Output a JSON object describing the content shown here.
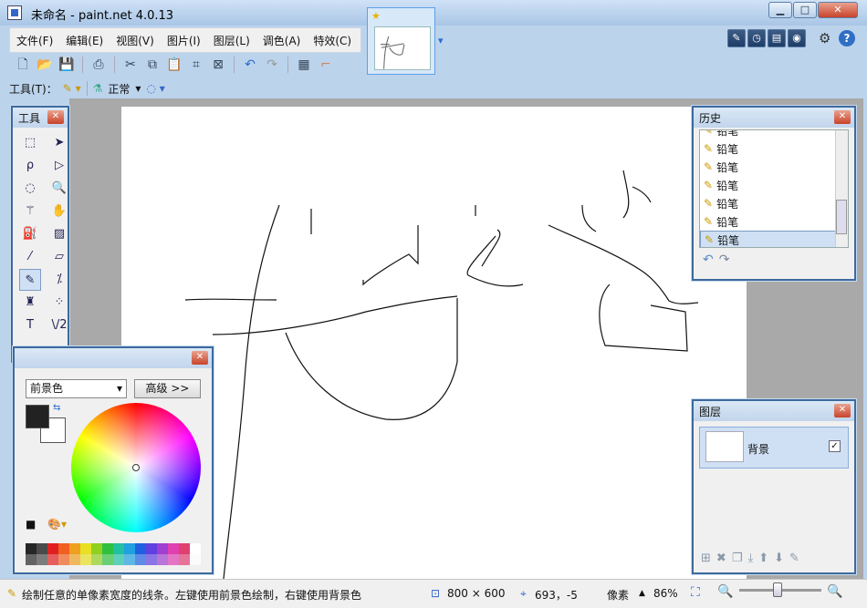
{
  "window": {
    "title": "未命名 - paint.net 4.0.13",
    "min": "▁",
    "max": "□",
    "close": "✕"
  },
  "menu": [
    "文件(F)",
    "编辑(E)",
    "视图(V)",
    "图片(I)",
    "图层(L)",
    "调色(A)",
    "特效(C)"
  ],
  "toolopts": {
    "tool_label": "工具(T)：",
    "blend_mode": "正常"
  },
  "tools_panel": {
    "title": "工具"
  },
  "colors_panel": {
    "selected": "前景色",
    "advanced": "高级 >>"
  },
  "history_panel": {
    "title": "历史",
    "items": [
      "铅笔",
      "铅笔",
      "铅笔",
      "铅笔",
      "铅笔",
      "铅笔",
      "铅笔"
    ]
  },
  "layers_panel": {
    "title": "图层",
    "layer_name": "背景",
    "checked": "✓"
  },
  "status": {
    "hint": "绘制任意的单像素宽度的线条。左键使用前景色绘制，右键使用背景色",
    "size": "800 × 600",
    "cursor": "693，-5",
    "unit": "像素",
    "zoom": "86%"
  },
  "colors": {
    "accent": "#3d6a9e",
    "palette": [
      "#262626",
      "#4a4a4a",
      "#e02020",
      "#f06020",
      "#f0a020",
      "#e8e020",
      "#90d020",
      "#30c040",
      "#20c0a0",
      "#20a0e0",
      "#2060e0",
      "#6040e0",
      "#a040d0",
      "#e040b0",
      "#e04070",
      "#ffffff"
    ]
  }
}
